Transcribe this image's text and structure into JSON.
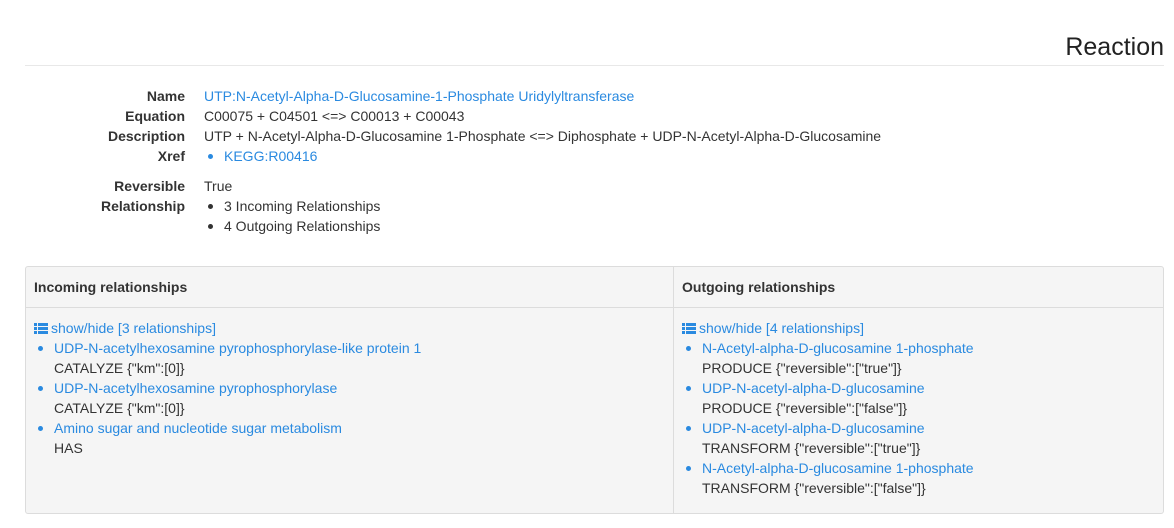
{
  "page": {
    "title": "Reaction"
  },
  "properties": {
    "name_label": "Name",
    "name_value": "UTP:N-Acetyl-Alpha-D-Glucosamine-1-Phosphate Uridylyltransferase",
    "equation_label": "Equation",
    "equation_value": "C00075 + C04501 <=> C00013 + C00043",
    "description_label": "Description",
    "description_value": "UTP + N-Acetyl-Alpha-D-Glucosamine 1-Phosphate <=> Diphosphate + UDP-N-Acetyl-Alpha-D-Glucosamine",
    "xref_label": "Xref",
    "xref_items": [
      "KEGG:R00416"
    ],
    "reversible_label": "Reversible",
    "reversible_value": "True",
    "relationship_label": "Relationship",
    "relationship_items": [
      "3 Incoming Relationships",
      "4 Outgoing Relationships"
    ]
  },
  "incoming": {
    "header": "Incoming relationships",
    "toggle_label": "show/hide [3 relationships]",
    "items": [
      {
        "name": "UDP-N-acetylhexosamine pyrophosphorylase-like protein 1",
        "detail": "CATALYZE {\"km\":[0]}"
      },
      {
        "name": "UDP-N-acetylhexosamine pyrophosphorylase",
        "detail": "CATALYZE {\"km\":[0]}"
      },
      {
        "name": "Amino sugar and nucleotide sugar metabolism",
        "detail": "HAS"
      }
    ]
  },
  "outgoing": {
    "header": "Outgoing relationships",
    "toggle_label": "show/hide [4 relationships]",
    "items": [
      {
        "name": "N-Acetyl-alpha-D-glucosamine 1-phosphate",
        "detail": "PRODUCE {\"reversible\":[\"true\"]}"
      },
      {
        "name": "UDP-N-acetyl-alpha-D-glucosamine",
        "detail": "PRODUCE {\"reversible\":[\"false\"]}"
      },
      {
        "name": "UDP-N-acetyl-alpha-D-glucosamine",
        "detail": "TRANSFORM {\"reversible\":[\"true\"]}"
      },
      {
        "name": "N-Acetyl-alpha-D-glucosamine 1-phosphate",
        "detail": "TRANSFORM {\"reversible\":[\"false\"]}"
      }
    ]
  },
  "colors": {
    "link": "#2a8ae0",
    "text": "#333333",
    "panel": "#f5f5f5",
    "border": "#dcdcdc"
  },
  "icons": {
    "toggle": "list-icon"
  }
}
